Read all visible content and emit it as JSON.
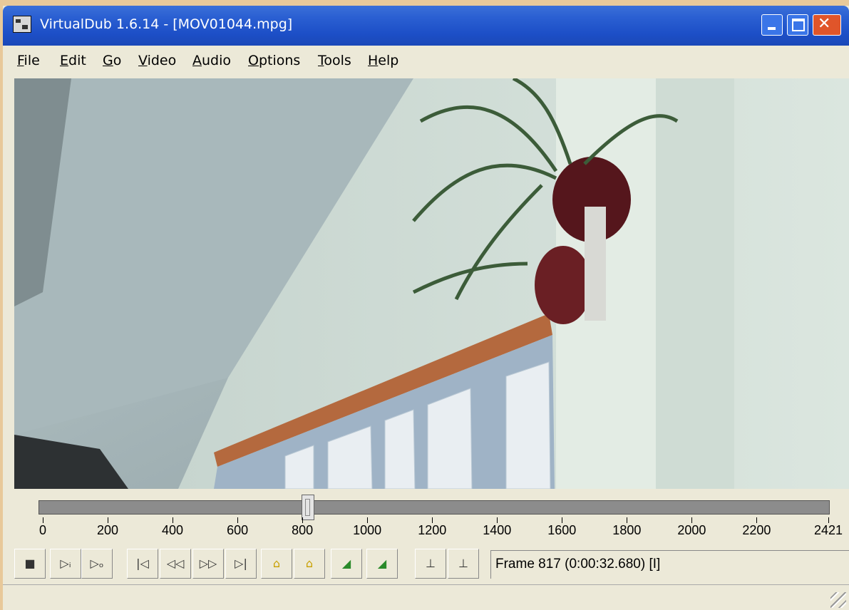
{
  "window": {
    "title": "VirtualDub 1.6.14 - [MOV01044.mpg]"
  },
  "menu": {
    "items": [
      {
        "label": "File",
        "underline": "F",
        "rest": "ile"
      },
      {
        "label": "Edit",
        "underline": "E",
        "rest": "dit"
      },
      {
        "label": "Go",
        "underline": "G",
        "rest": "o"
      },
      {
        "label": "Video",
        "underline": "V",
        "rest": "ideo"
      },
      {
        "label": "Audio",
        "underline": "A",
        "rest": "udio"
      },
      {
        "label": "Options",
        "underline": "O",
        "rest": "ptions"
      },
      {
        "label": "Tools",
        "underline": "T",
        "rest": "ools"
      },
      {
        "label": "Help",
        "underline": "H",
        "rest": "elp"
      }
    ]
  },
  "timeline": {
    "max_frame": 2421,
    "current_frame": 817,
    "tick_labels": [
      "0",
      "200",
      "400",
      "600",
      "800",
      "1000",
      "1200",
      "1400",
      "1600",
      "1800",
      "2000",
      "2200",
      "2421"
    ]
  },
  "toolbar": {
    "buttons": [
      {
        "name": "stop-button",
        "glyph": "■"
      },
      {
        "name": "play-input-button",
        "glyph": "▷ᵢ"
      },
      {
        "name": "play-output-button",
        "glyph": "▷ₒ"
      },
      {
        "name": "go-start-button",
        "glyph": "|◁"
      },
      {
        "name": "prev-frame-button",
        "glyph": "◁◁"
      },
      {
        "name": "next-frame-button",
        "glyph": "▷▷"
      },
      {
        "name": "go-end-button",
        "glyph": "▷|"
      },
      {
        "name": "prev-keyframe-button",
        "glyph": "🔑"
      },
      {
        "name": "next-keyframe-button",
        "glyph": "🔑"
      },
      {
        "name": "prev-scene-button",
        "glyph": "◢"
      },
      {
        "name": "next-scene-button",
        "glyph": "◢"
      },
      {
        "name": "mark-in-button",
        "glyph": "◢"
      },
      {
        "name": "mark-out-button",
        "glyph": "◣"
      }
    ]
  },
  "status": {
    "frame_text": "Frame 817 (0:00:32.680) [I]"
  }
}
